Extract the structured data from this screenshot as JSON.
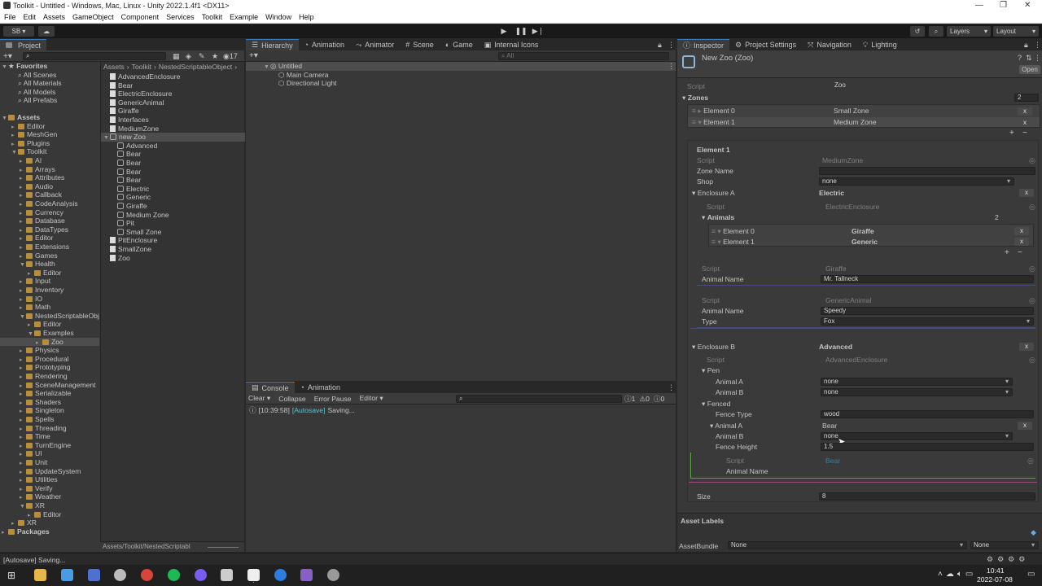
{
  "window": {
    "title": "Toolkit - Untitled - Windows, Mac, Linux - Unity 2022.1.4f1 <DX11>"
  },
  "menu": [
    "File",
    "Edit",
    "Assets",
    "GameObject",
    "Component",
    "Services",
    "Toolkit",
    "Example",
    "Window",
    "Help"
  ],
  "toolbar": {
    "account": "SB",
    "layers": "Layers",
    "layout": "Layout"
  },
  "project": {
    "tab": "Project",
    "count": "17",
    "favorites_label": "Favorites",
    "favorites": [
      "All Scenes",
      "All Materials",
      "All Models",
      "All Prefabs"
    ],
    "assets_label": "Assets",
    "packages_label": "Packages",
    "path_bottom": "Assets/Toolkit/NestedScriptabl",
    "breadcrumb": [
      "Assets",
      "Toolkit",
      "NestedScriptableObject"
    ],
    "tree_items": [
      "Editor",
      "MeshGen",
      "Plugins",
      "Toolkit",
      "AI",
      "Arrays",
      "Attributes",
      "Audio",
      "Callback",
      "CodeAnalysis",
      "Currency",
      "Database",
      "DataTypes",
      "Editor",
      "Extensions",
      "Games",
      "Health",
      "Editor",
      "Input",
      "Inventory",
      "IO",
      "Math",
      "NestedScriptableObje",
      "Editor",
      "Examples",
      "Zoo",
      "Physics",
      "Procedural",
      "Prototyping",
      "Rendering",
      "SceneManagement",
      "Serializable",
      "Shaders",
      "Singleton",
      "Spells",
      "Threading",
      "Time",
      "TurnEngine",
      "UI",
      "Unit",
      "UpdateSystem",
      "Utilities",
      "Verify",
      "Weather",
      "XR",
      "Editor",
      "XR"
    ],
    "files": [
      "AdvancedEnclosure",
      "Bear",
      "ElectricEnclosure",
      "GenericAnimal",
      "Giraffe",
      "Interfaces",
      "MediumZone",
      "new Zoo",
      "Advanced",
      "Bear",
      "Bear",
      "Bear",
      "Bear",
      "Electric",
      "Generic",
      "Giraffe",
      "Medium Zone",
      "Pit",
      "Small Zone",
      "PitEnclosure",
      "SmallZone",
      "Zoo"
    ]
  },
  "scene_tabs": [
    "Hierarchy",
    "Animation",
    "Animator",
    "Scene",
    "Game",
    "Internal Icons"
  ],
  "hierarchy": {
    "search_placeholder": "All",
    "scene": "Untitled",
    "items": [
      "Main Camera",
      "Directional Light"
    ]
  },
  "console": {
    "tabs": [
      "Console",
      "Animation"
    ],
    "buttons": [
      "Clear",
      "Collapse",
      "Error Pause",
      "Editor"
    ],
    "counts": [
      "1",
      "0",
      "0"
    ],
    "log_time": "[10:39:58]",
    "log_tag": "[Autosave]",
    "log_msg": "Saving..."
  },
  "inspector": {
    "tabs": [
      "Inspector",
      "Project Settings",
      "Navigation",
      "Lighting"
    ],
    "asset_title": "New Zoo (Zoo)",
    "open_btn": "Open",
    "script_label": "Script",
    "script_zoo": "Zoo",
    "zones_label": "Zones",
    "zones_count": "2",
    "element0_label": "Element 0",
    "element0_value": "Small Zone",
    "element1_label": "Element 1",
    "element1_value": "Medium Zone",
    "element1_header": "Element 1",
    "mz_script": "MediumZone",
    "zone_name_label": "Zone Name",
    "shop_label": "Shop",
    "shop_value": "none",
    "enc_a_label": "Enclosure A",
    "enc_a_value": "Electric",
    "ee_script": "ElectricEnclosure",
    "animals_label": "Animals",
    "animals_count": "2",
    "animal0_label": "Element 0",
    "animal0_value": "Giraffe",
    "animal1_label": "Element 1",
    "animal1_value": "Generic",
    "giraffe_script": "Giraffe",
    "animal_name_label": "Animal Name",
    "giraffe_name": "Mr. Tallneck",
    "generic_script": "GenericAnimal",
    "generic_name": "Speedy",
    "type_label": "Type",
    "type_value": "Fox",
    "enc_b_label": "Enclosure B",
    "enc_b_value": "Advanced",
    "ae_script": "AdvancedEnclosure",
    "pen_label": "Pen",
    "animal_a_label": "Animal A",
    "animal_b_label": "Animal B",
    "pen_a": "none",
    "pen_b": "none",
    "fenced_label": "Fenced",
    "fence_type_label": "Fence Type",
    "fence_type_value": "wood",
    "fenced_a": "Bear",
    "fenced_b": "none",
    "fence_height_label": "Fence Height",
    "fence_height_value": "1.5",
    "bear_script": "Bear",
    "size_label": "Size",
    "size_value": "8",
    "asset_labels": "Asset Labels",
    "assetbundle_label": "AssetBundle",
    "assetbundle_value": "None",
    "variant_value": "None"
  },
  "status": {
    "text": "[Autosave] Saving..."
  },
  "taskbar": {
    "time": "10:41",
    "date": "2022-07-08"
  }
}
